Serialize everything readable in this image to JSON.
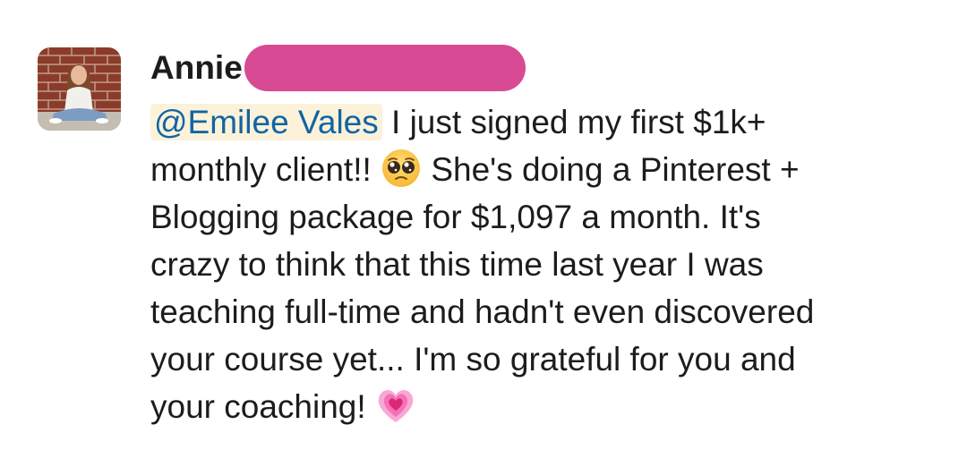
{
  "message": {
    "sender_name": "Annie",
    "mention": "@Emilee Vales",
    "lines": [
      " I just signed my first $1k+",
      "monthly client!!",
      " She's doing a Pinterest +",
      "Blogging package for $1,097 a month. It's",
      "crazy to think that this time last year I was",
      "teaching full-time and hadn't even discovered",
      "your course yet... I'm so grateful for you and",
      "your coaching!"
    ],
    "emojis": [
      "pleading-face",
      "growing-heart"
    ]
  },
  "colors": {
    "redaction": "#d84a93",
    "mention_text": "#1264a3",
    "mention_background": "#fbf2d9"
  }
}
